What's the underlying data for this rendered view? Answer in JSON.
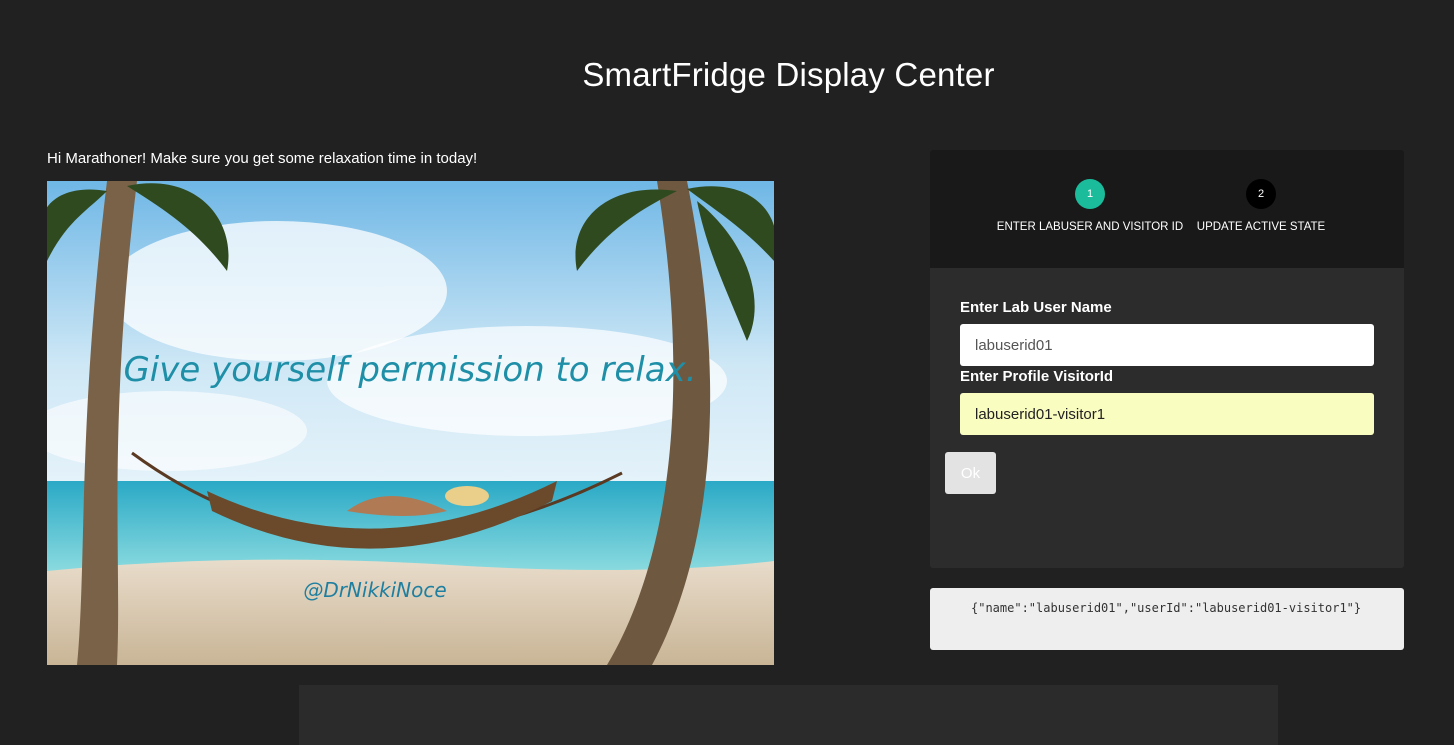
{
  "header": {
    "title": "SmartFridge Display Center"
  },
  "message": {
    "greeting": "Hi Marathoner! Make sure you get some relaxation time in today!",
    "image_caption": "Give yourself permission to relax.",
    "image_credit": "@DrNikkiNoce"
  },
  "wizard": {
    "steps": [
      {
        "number": "1",
        "label": "ENTER LABUSER AND VISITOR ID",
        "active": true
      },
      {
        "number": "2",
        "label": "UPDATE ACTIVE STATE",
        "active": false
      }
    ],
    "lab_user_label": "Enter Lab User Name",
    "lab_user_value": "labuserid01",
    "visitor_label": "Enter Profile VisitorId",
    "visitor_value": "labuserid01-visitor1",
    "ok_label": "Ok"
  },
  "output": {
    "json": "{\"name\":\"labuserid01\",\"userId\":\"labuserid01-visitor1\"}"
  },
  "colors": {
    "accent": "#1abc9c",
    "background": "#212121",
    "autofill": "#fafdc0"
  }
}
